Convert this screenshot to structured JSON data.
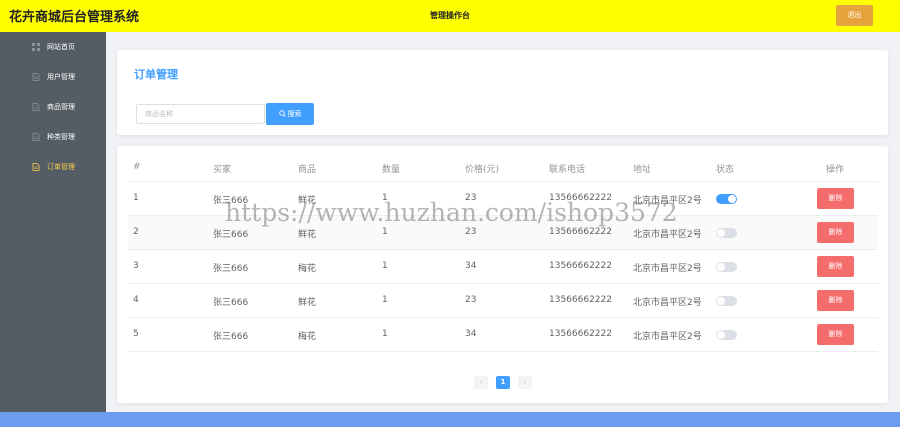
{
  "header": {
    "brand": "花卉商城后台管理系统",
    "center_title": "管理操作台",
    "logout_label": "退出",
    "background": "#ffff00",
    "logout_color": "#e6a23c"
  },
  "sidebar": {
    "background": "#545c64",
    "active_color": "#ffd04b",
    "items": [
      {
        "label": "网站首页",
        "icon": "grid-icon"
      },
      {
        "label": "用户管理",
        "icon": "document-icon"
      },
      {
        "label": "商品管理",
        "icon": "document-icon"
      },
      {
        "label": "种类管理",
        "icon": "document-icon"
      },
      {
        "label": "订单管理",
        "icon": "document-icon",
        "active": true
      }
    ]
  },
  "page": {
    "title": "订单管理",
    "search_placeholder": "商品名称",
    "search_value": "",
    "search_button": "搜索"
  },
  "table": {
    "columns": [
      "#",
      "买家",
      "商品",
      "数量",
      "价格(元)",
      "联系电话",
      "地址",
      "状态",
      "操作"
    ],
    "delete_label": "删除",
    "rows": [
      {
        "id": "1",
        "buyer": "张三666",
        "product": "鲜花",
        "qty": "1",
        "price": "23",
        "phone": "13566662222",
        "address": "北京市昌平区2号",
        "status_on": true
      },
      {
        "id": "2",
        "buyer": "张三666",
        "product": "鲜花",
        "qty": "1",
        "price": "23",
        "phone": "13566662222",
        "address": "北京市昌平区2号",
        "status_on": false
      },
      {
        "id": "3",
        "buyer": "张三666",
        "product": "梅花",
        "qty": "1",
        "price": "34",
        "phone": "13566662222",
        "address": "北京市昌平区2号",
        "status_on": false
      },
      {
        "id": "4",
        "buyer": "张三666",
        "product": "鲜花",
        "qty": "1",
        "price": "23",
        "phone": "13566662222",
        "address": "北京市昌平区2号",
        "status_on": false
      },
      {
        "id": "5",
        "buyer": "张三666",
        "product": "梅花",
        "qty": "1",
        "price": "34",
        "phone": "13566662222",
        "address": "北京市昌平区2号",
        "status_on": false
      }
    ]
  },
  "pagination": {
    "prev": "‹",
    "current": "1",
    "next": "›"
  },
  "watermark": "https://www.huzhan.com/ishop3572",
  "colors": {
    "primary": "#409eff",
    "danger": "#f56c6c",
    "footer": "#6c9cf0"
  }
}
